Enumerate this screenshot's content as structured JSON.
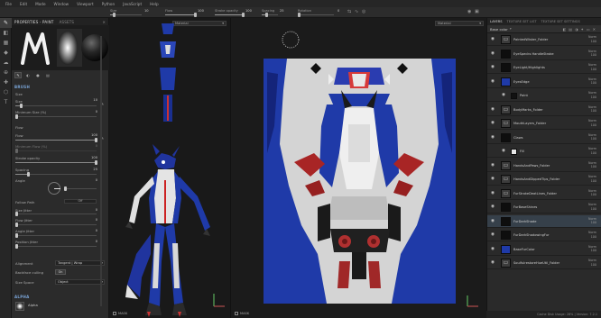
{
  "menu": [
    "File",
    "Edit",
    "Mode",
    "Window",
    "Viewport",
    "Python",
    "JavaScript",
    "Help"
  ],
  "toolbar": {
    "size_label": "Size",
    "size_value": "10",
    "flow_label": "Flow",
    "flow_value": "100",
    "stroke_opacity_label": "Stroke opacity",
    "stroke_opacity_value": "100",
    "spacing_label": "Spacing",
    "spacing_value": "25",
    "angle_label": "Rotation",
    "angle_value": "0"
  },
  "properties": {
    "tab_properties": "PROPERTIES - PAINT",
    "tab_assets": "ASSETS",
    "section_brush": "BRUSH",
    "size_section": "Size",
    "size_label": "Size",
    "size_value": "10",
    "min_size_label": "Minimum Size (%)",
    "min_size_value": "0",
    "flow_section": "Flow",
    "flow_label": "Flow",
    "flow_value": "100",
    "min_flow_label": "Minimum Flow (%)",
    "min_flow_value": "0",
    "stroke_opacity_label": "Stroke opacity",
    "stroke_opacity_value": "100",
    "spacing_label": "Spacing",
    "spacing_value": "25",
    "angle_label": "Angle",
    "angle_value": "0",
    "follow_path_label": "Follow Path",
    "follow_path_value": "Off",
    "size_jitter_label": "Size Jitter",
    "size_jitter_value": "0",
    "flow_jitter_label": "Flow Jitter",
    "flow_jitter_value": "0",
    "angle_jitter_label": "Angle Jitter",
    "angle_jitter_value": "0",
    "position_jitter_label": "Position Jitter",
    "position_jitter_value": "0",
    "alignment_label": "Alignment",
    "alignment_value": "Tangent | Wrap",
    "backface_label": "Backface culling",
    "backface_value": "On",
    "size_space_label": "Size Space",
    "size_space_value": "Object",
    "section_alpha": "ALPHA",
    "alpha_label": "Alpha"
  },
  "uv_view": {
    "channel": "Material",
    "mask_label": "MASK"
  },
  "view3d": {
    "channel": "Material",
    "mask_label": "MASK"
  },
  "layers": {
    "tab_layers": "LAYERS",
    "tab_texture_set_list": "TEXTURE SET LIST",
    "tab_texture_set_settings": "TEXTURE SET SETTINGS",
    "blend_select": "Base color",
    "rows": [
      {
        "name": "PaintedWisker_Folder",
        "blend": "Norm",
        "opacity": "100",
        "kind": "folder"
      },
      {
        "name": "EyeSpecks HandleStroke",
        "blend": "Norm",
        "opacity": "100",
        "kind": "dark"
      },
      {
        "name": "EyeLight/Highlights",
        "blend": "Norm",
        "opacity": "100",
        "kind": "dark"
      },
      {
        "name": "EyesEdge",
        "blend": "Norm",
        "opacity": "100",
        "kind": "blue"
      },
      {
        "name": "Paint",
        "blend": "Norm",
        "opacity": "100",
        "kind": "paint"
      },
      {
        "name": "BodyMarks_Folder",
        "blend": "Norm",
        "opacity": "100",
        "kind": "folder"
      },
      {
        "name": "MouthLayers_Folder",
        "blend": "Norm",
        "opacity": "100",
        "kind": "folder"
      },
      {
        "name": "Claws",
        "blend": "Norm",
        "opacity": "100",
        "kind": "dark"
      },
      {
        "name": "Fill",
        "blend": "Norm",
        "opacity": "100",
        "kind": "fill"
      },
      {
        "name": "HandsAndPaws_Folder",
        "blend": "Norm",
        "opacity": "100",
        "kind": "folder"
      },
      {
        "name": "HandsAndDippedTips_Folder",
        "blend": "Norm",
        "opacity": "100",
        "kind": "folder"
      },
      {
        "name": "FurStrokeDeatLines_Folder",
        "blend": "Norm",
        "opacity": "100",
        "kind": "folder"
      },
      {
        "name": "FurBaseShines",
        "blend": "Norm",
        "opacity": "100",
        "kind": "dark"
      },
      {
        "name": "FurDarkShade",
        "blend": "Norm",
        "opacity": "100",
        "kind": "dark"
      },
      {
        "name": "FurDarkShadowingFur",
        "blend": "Norm",
        "opacity": "100",
        "kind": "dark"
      },
      {
        "name": "BaseFurColor",
        "blend": "Norm",
        "opacity": "100",
        "kind": "blue"
      },
      {
        "name": "SoulfulrestoreHueUtil_Folder",
        "blend": "Norm",
        "opacity": "100",
        "kind": "folder"
      }
    ],
    "status": "Cache Disk Usage: 28% | Version: 7.2.1"
  },
  "colors": {
    "accent": "#7aa5d8",
    "fur_blue": "#1f3aa8",
    "fur_white": "#e6e6e6",
    "claw_red": "#b0302a"
  },
  "icons": {
    "eye": "eye-icon",
    "folder": "folder-icon",
    "brush": "brush-icon"
  }
}
